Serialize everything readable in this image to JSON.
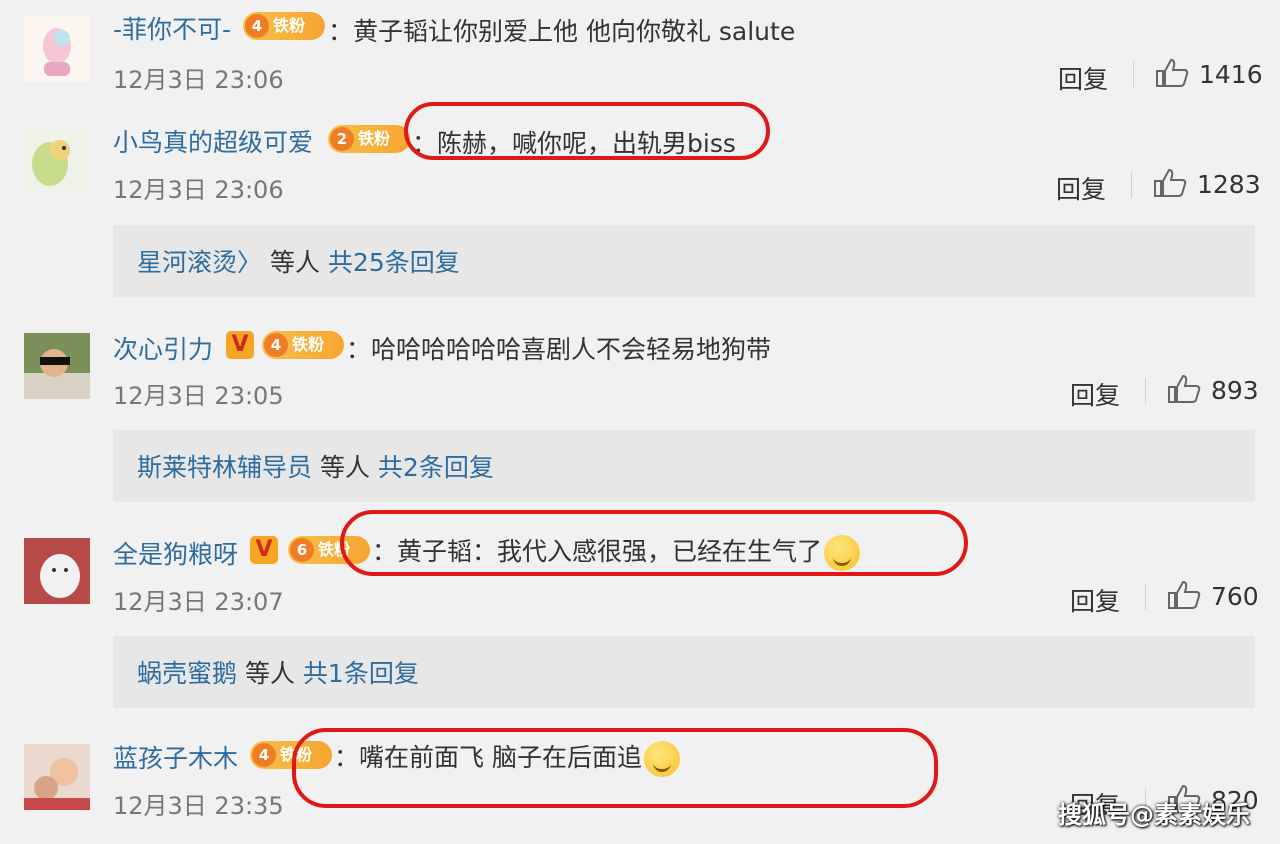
{
  "comments": [
    {
      "user": "-菲你不可-",
      "fan_level": "4",
      "fan_label": "铁粉",
      "verified": false,
      "text": "：黄子韬让你别爱上他 他向你敬礼 salute",
      "time": "12月3日 23:06",
      "reply_label": "回复",
      "likes": "1416"
    },
    {
      "user": "小鸟真的超级可爱",
      "fan_level": "2",
      "fan_label": "铁粉",
      "verified": false,
      "text": "：陈赫，喊你呢，出轨男biss",
      "time": "12月3日 23:06",
      "reply_label": "回复",
      "likes": "1283",
      "sub": {
        "user": "星河滚烫〉",
        "mid": " 等人 ",
        "link": "共25条回复"
      }
    },
    {
      "user": "次心引力",
      "fan_level": "4",
      "fan_label": "铁粉",
      "verified": true,
      "verified_label": "V",
      "text": "：哈哈哈哈哈哈喜剧人不会轻易地狗带",
      "time": "12月3日 23:05",
      "reply_label": "回复",
      "likes": "893",
      "sub": {
        "user": "斯莱特林辅导员",
        "mid": " 等人 ",
        "link": "共2条回复"
      }
    },
    {
      "user": "全是狗粮呀",
      "fan_level": "6",
      "fan_label": "铁粉",
      "verified": true,
      "verified_label": "V",
      "text": "：黄子韬：我代入感很强，已经在生气了",
      "time": "12月3日 23:07",
      "reply_label": "回复",
      "likes": "760",
      "sub": {
        "user": "蜗壳蜜鹅",
        "mid": " 等人 ",
        "link": "共1条回复"
      }
    },
    {
      "user": "蓝孩子木木",
      "fan_level": "4",
      "fan_label": "铁粉",
      "verified": false,
      "text": "：嘴在前面飞 脑子在后面追",
      "time": "12月3日 23:35",
      "reply_label": "回复",
      "likes": "820"
    }
  ],
  "watermark": "搜狐号@素素娱乐",
  "colors": {
    "link": "#2f6ca0",
    "highlight": "#e11818",
    "badge": "#f5a623"
  },
  "icons": {
    "like": "thumbs-up-icon",
    "emoji_smile": "smirk-emoji-icon",
    "emoji_laugh": "laugh-cry-emoji-icon"
  }
}
